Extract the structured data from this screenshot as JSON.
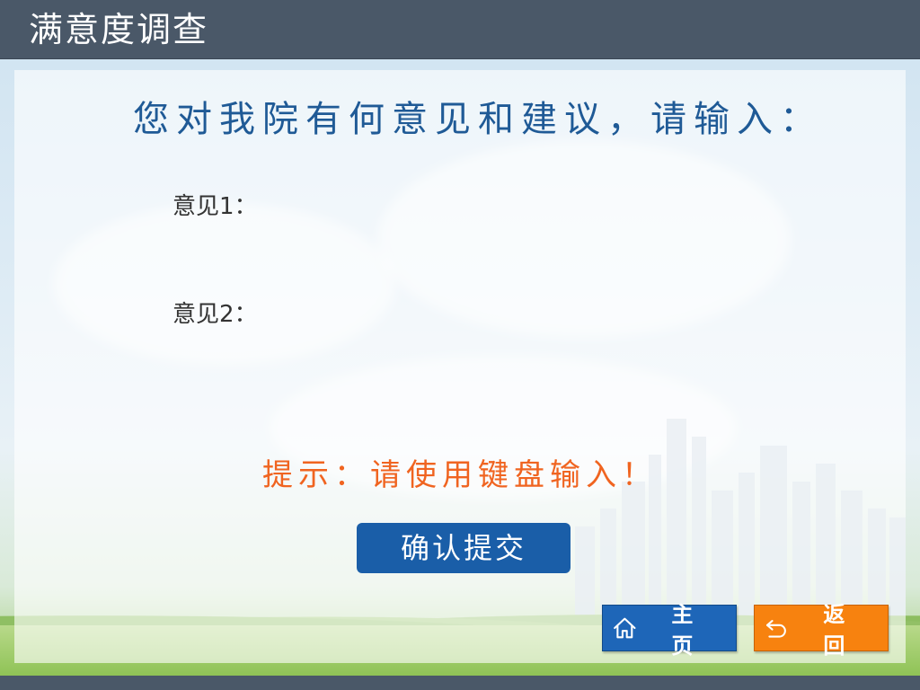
{
  "header": {
    "title": "满意度调查"
  },
  "survey": {
    "question": "您对我院有何意见和建议，请输入：",
    "opinions": [
      {
        "label": "意见1：",
        "value": ""
      },
      {
        "label": "意见2：",
        "value": ""
      }
    ],
    "hint": "提示：请使用键盘输入！",
    "submit_label": "确认提交"
  },
  "nav": {
    "home_label": "主 页",
    "home_icon": "home-icon",
    "back_label": "返 回",
    "back_icon": "back-arrow-icon"
  },
  "colors": {
    "header_bg": "#4a5868",
    "question_text": "#1f5a96",
    "hint_text": "#f06420",
    "submit_bg": "#1a5ea8",
    "home_bg": "#1e66b8",
    "back_bg": "#f7820f"
  }
}
